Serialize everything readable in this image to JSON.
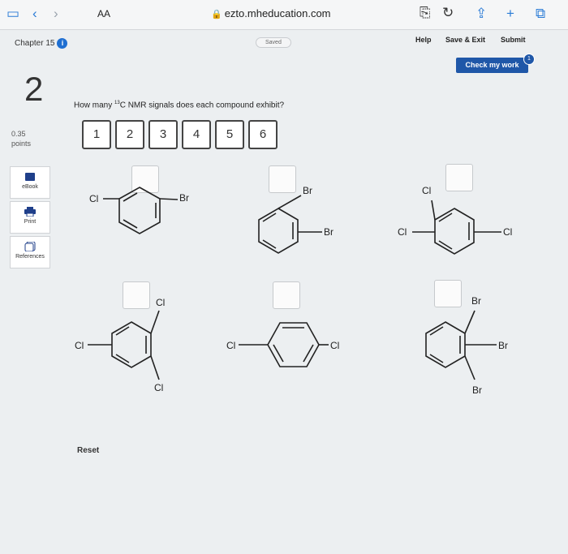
{
  "browser": {
    "text_size_label": "AA",
    "url": "ezto.mheducation.com"
  },
  "header": {
    "chapter": "Chapter 15",
    "saved": "Saved",
    "help": "Help",
    "save_exit": "Save & Exit",
    "submit": "Submit",
    "check_my_work": "Check my work",
    "check_badge": "1"
  },
  "question": {
    "number": "2",
    "points_value": "0.35",
    "points_label": "points",
    "prompt_pre": "How many ",
    "prompt_sup": "13",
    "prompt_post": "C NMR signals does each compound exhibit?",
    "answer_tiles": [
      "1",
      "2",
      "3",
      "4",
      "5",
      "6"
    ],
    "reset": "Reset"
  },
  "tools": {
    "ebook": "eBook",
    "print": "Print",
    "references": "References"
  },
  "molecules": {
    "m1": {
      "cl": "Cl",
      "br": "Br"
    },
    "m2": {
      "br_top": "Br",
      "br_right": "Br"
    },
    "m3": {
      "cl_top": "Cl",
      "cl_left": "Cl",
      "cl_right": "Cl"
    },
    "m4": {
      "cl_top": "Cl",
      "cl_left": "Cl",
      "cl_bottom": "Cl"
    },
    "m5": {
      "cl_left": "Cl",
      "cl_right": "Cl"
    },
    "m6": {
      "br_top": "Br",
      "br_right": "Br",
      "br_bottom": "Br"
    }
  },
  "colors": {
    "accent": "#1f57a8",
    "browser_blue": "#2a7bd6"
  }
}
